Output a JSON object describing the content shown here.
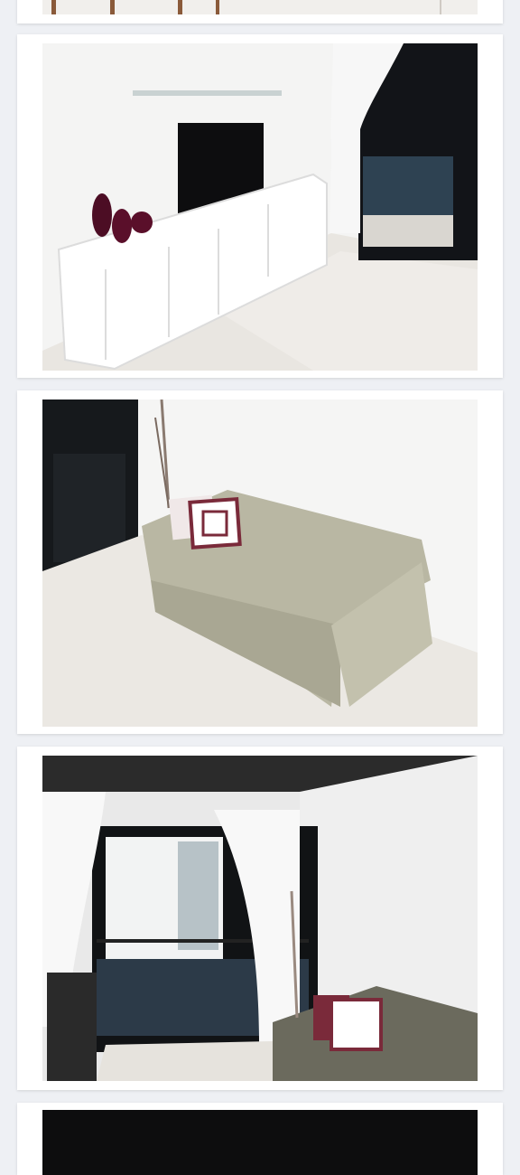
{
  "gallery": {
    "photos": [
      {
        "alt": ""
      },
      {
        "alt": ""
      },
      {
        "alt": ""
      },
      {
        "alt": ""
      },
      {
        "alt": ""
      }
    ]
  },
  "colors": {
    "page_background": "#eef0f4",
    "card_background": "#ffffff",
    "wall": "#f3f3f2",
    "floor": "#e7e4df",
    "sofa": "#b9b7a3",
    "tv": "#111111",
    "vase": "#5a0f2a",
    "cushion_print": "#7a2a3a",
    "dark_glass": "#16191c",
    "balcony_tile": "#2c3a48"
  },
  "icons": [
    "photo-image-icon"
  ]
}
